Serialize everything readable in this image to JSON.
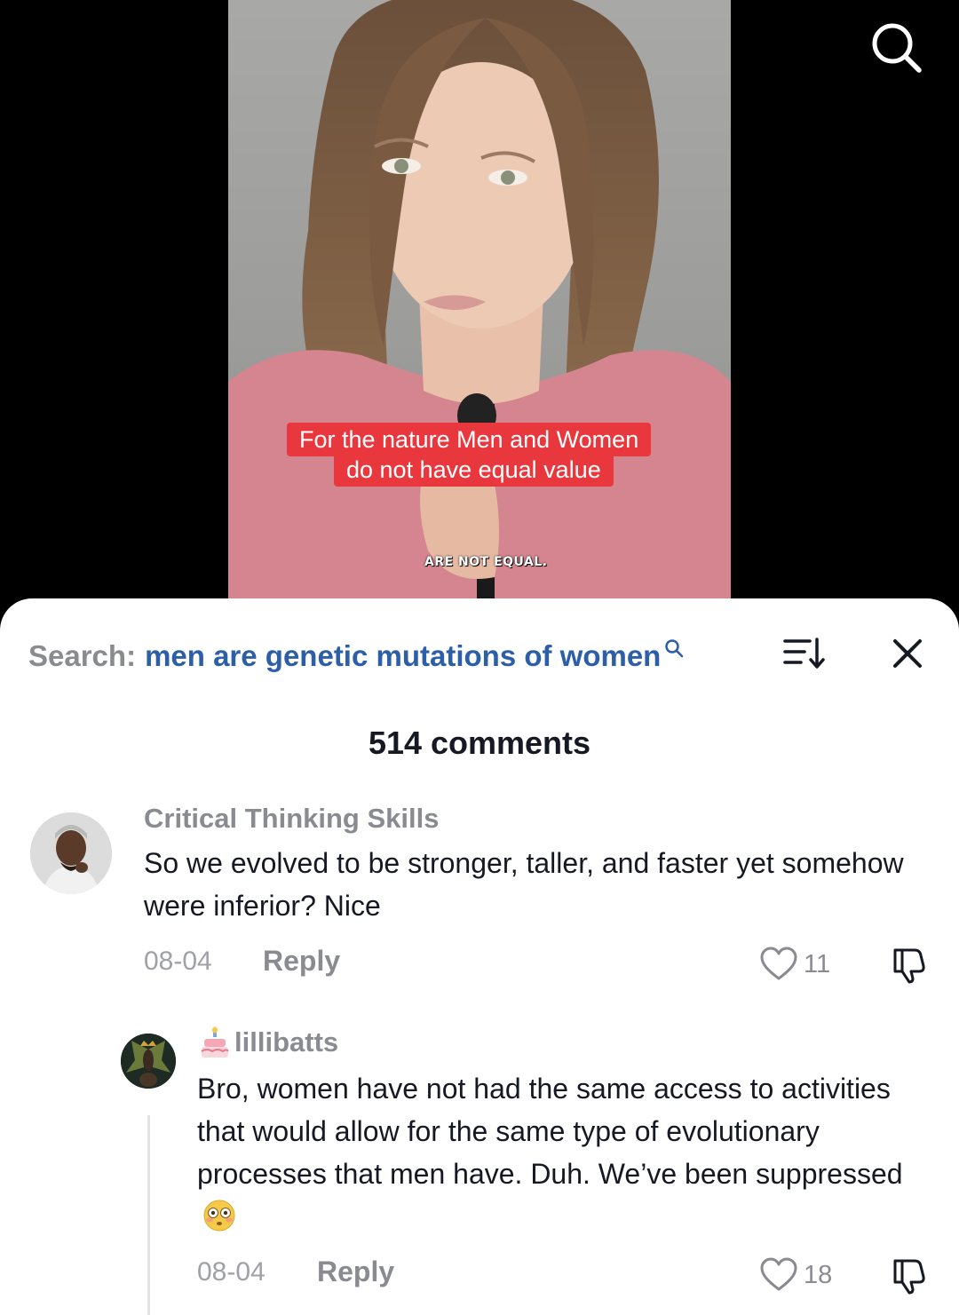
{
  "video": {
    "caption_line1": "For the nature Men and Women",
    "caption_line2": "do not have equal value",
    "overlay_text": "ARE NOT EQUAL."
  },
  "icons": {
    "top_search": "search-icon",
    "sort": "sort-icon",
    "close": "close-icon",
    "like": "heart-icon",
    "dislike": "thumbs-down-icon"
  },
  "search": {
    "prefix": "Search:",
    "query": "men are genetic mutations of women"
  },
  "comments_header": {
    "count_label": "514 comments"
  },
  "comments": [
    {
      "username": "Critical Thinking Skills",
      "text": "So we evolved to be stronger, taller, and faster yet somehow were inferior? Nice",
      "date": "08-04",
      "reply_label": "Reply",
      "likes": "11"
    },
    {
      "username": "lillibatts",
      "text": "Bro, women have not had the same access to activities that would allow for the same type of evolutionary processes that men have. Duh. We’ve been suppressed",
      "emoji": "flushed-face",
      "date": "08-04",
      "reply_label": "Reply",
      "likes": "18"
    }
  ],
  "colors": {
    "caption_bg": "#e8383d",
    "search_query": "#2d5ea8",
    "muted_text": "#8a8b91",
    "primary_text": "#161823"
  }
}
